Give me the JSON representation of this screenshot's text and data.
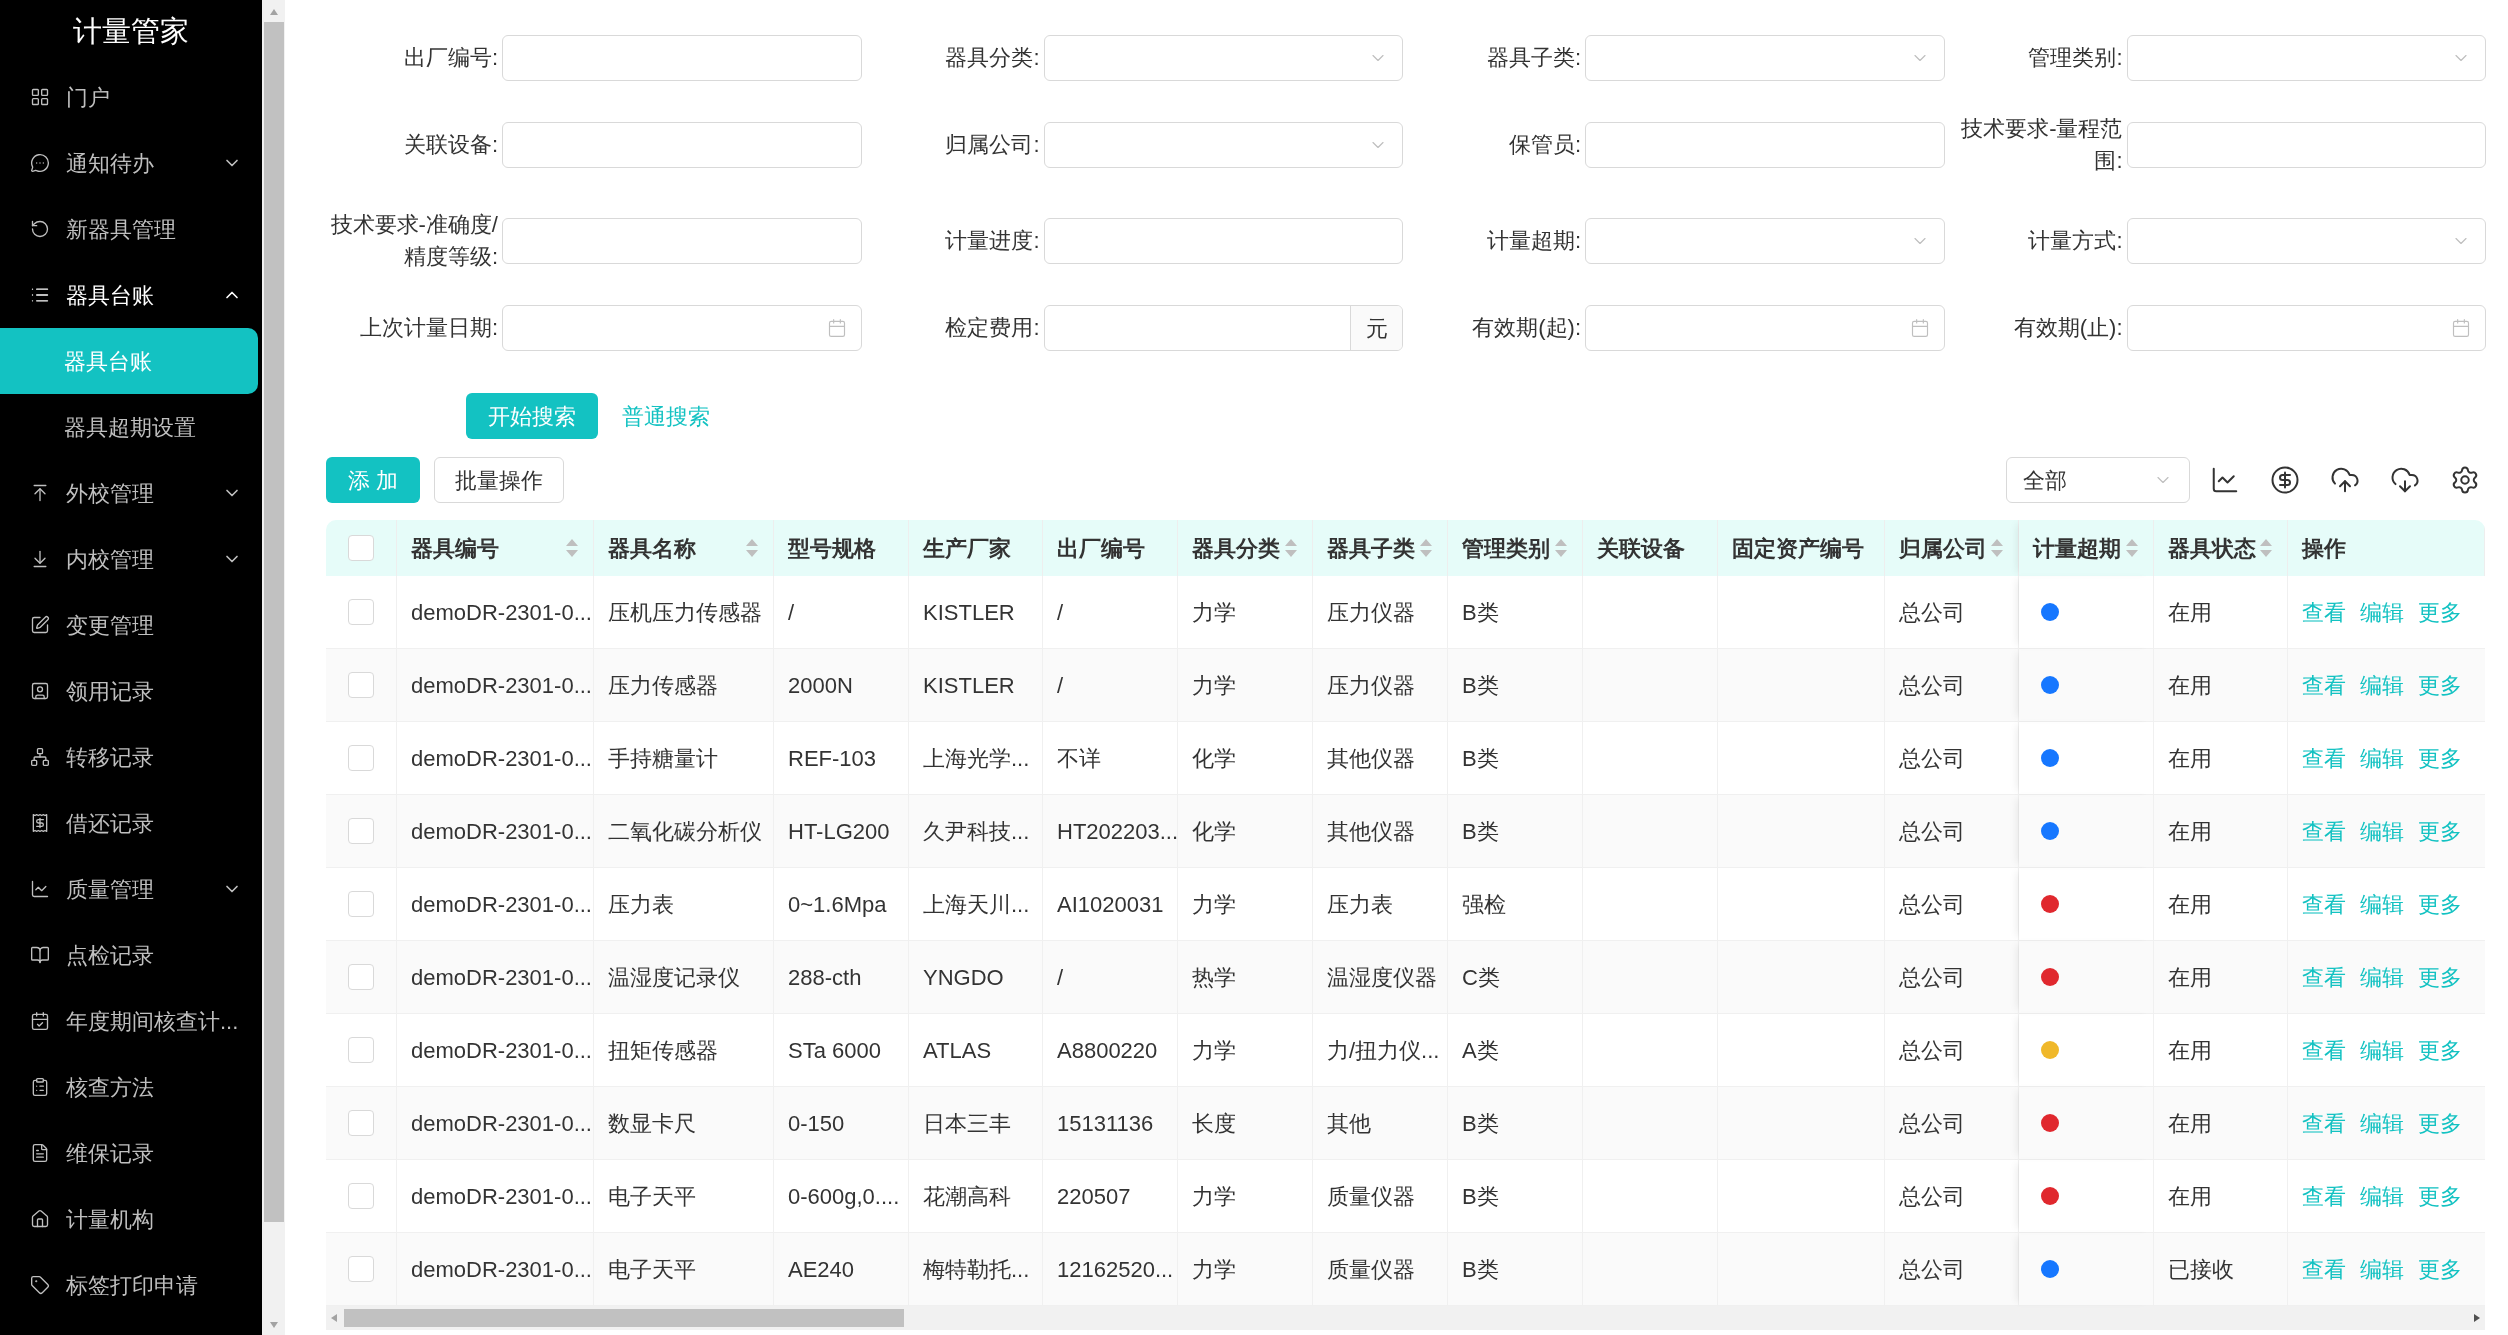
{
  "sidebar": {
    "title": "计量管家",
    "items": [
      {
        "label": "门户",
        "selected": false
      },
      {
        "label": "通知待办",
        "selected": false,
        "expanded": false
      },
      {
        "label": "新器具管理",
        "selected": false
      },
      {
        "label": "器具台账",
        "selected": false,
        "expanded": true,
        "children": [
          {
            "label": "器具台账",
            "selected": true
          },
          {
            "label": "器具超期设置",
            "selected": false
          }
        ]
      },
      {
        "label": "外校管理",
        "selected": false,
        "expanded": false
      },
      {
        "label": "内校管理",
        "selected": false,
        "expanded": false
      },
      {
        "label": "变更管理",
        "selected": false
      },
      {
        "label": "领用记录",
        "selected": false
      },
      {
        "label": "转移记录",
        "selected": false
      },
      {
        "label": "借还记录",
        "selected": false
      },
      {
        "label": "质量管理",
        "selected": false,
        "expanded": false
      },
      {
        "label": "点检记录",
        "selected": false
      },
      {
        "label": "年度期间核查计...",
        "selected": false
      },
      {
        "label": "核查方法",
        "selected": false
      },
      {
        "label": "维保记录",
        "selected": false
      },
      {
        "label": "计量机构",
        "selected": false
      },
      {
        "label": "标签打印申请",
        "selected": false
      }
    ]
  },
  "filters": [
    {
      "label": "出厂编号:",
      "kind": "text"
    },
    {
      "label": "器具分类:",
      "kind": "select"
    },
    {
      "label": "器具子类:",
      "kind": "select"
    },
    {
      "label": "管理类别:",
      "kind": "select"
    },
    {
      "label": "关联设备:",
      "kind": "text"
    },
    {
      "label": "归属公司:",
      "kind": "select"
    },
    {
      "label": "保管员:",
      "kind": "text"
    },
    {
      "label": "技术要求-量程范围:",
      "kind": "text"
    },
    {
      "label": "技术要求-准确度/精度等级:",
      "kind": "text"
    },
    {
      "label": "计量进度:",
      "kind": "text"
    },
    {
      "label": "计量超期:",
      "kind": "select"
    },
    {
      "label": "计量方式:",
      "kind": "select"
    },
    {
      "label": "上次计量日期:",
      "kind": "date"
    },
    {
      "label": "检定费用:",
      "kind": "currency",
      "suffix": "元"
    },
    {
      "label": "有效期(起):",
      "kind": "date"
    },
    {
      "label": "有效期(止):",
      "kind": "date"
    }
  ],
  "search_button": "开始搜索",
  "simple_search_link": "普通搜索",
  "add_button": "添 加",
  "batch_button": "批量操作",
  "scope_select": {
    "value": "全部"
  },
  "table": {
    "all_checked": false,
    "columns": [
      {
        "label": "器具编号",
        "sortable": true
      },
      {
        "label": "器具名称",
        "sortable": true
      },
      {
        "label": "型号规格",
        "sortable": false
      },
      {
        "label": "生产厂家",
        "sortable": false
      },
      {
        "label": "出厂编号",
        "sortable": false
      },
      {
        "label": "器具分类",
        "sortable": true
      },
      {
        "label": "器具子类",
        "sortable": true
      },
      {
        "label": "管理类别",
        "sortable": true
      },
      {
        "label": "关联设备",
        "sortable": false
      },
      {
        "label": "固定资产编号",
        "sortable": false
      },
      {
        "label": "归属公司",
        "sortable": true
      },
      {
        "label": "计量超期",
        "sortable": true
      },
      {
        "label": "器具状态",
        "sortable": true
      },
      {
        "label": "操作",
        "sortable": false
      }
    ],
    "rows": [
      {
        "checked": false,
        "id": "demoDR-2301-0...",
        "name": "压机压力传感器",
        "model": "/",
        "maker": "KISTLER",
        "serial": "/",
        "category": "力学",
        "subcategory": "压力仪器",
        "mgmt_class": "B类",
        "company": "总公司",
        "color": "#1677ff",
        "status": "在用",
        "actions": [
          "查看",
          "编辑",
          "更多"
        ]
      },
      {
        "checked": false,
        "id": "demoDR-2301-0...",
        "name": "压力传感器",
        "model": "2000N",
        "maker": "KISTLER",
        "serial": "/",
        "category": "力学",
        "subcategory": "压力仪器",
        "mgmt_class": "B类",
        "company": "总公司",
        "color": "#1677ff",
        "status": "在用",
        "actions": [
          "查看",
          "编辑",
          "更多"
        ]
      },
      {
        "checked": false,
        "id": "demoDR-2301-0...",
        "name": "手持糖量计",
        "model": "REF-103",
        "maker": "上海光学...",
        "serial": "不详",
        "category": "化学",
        "subcategory": "其他仪器",
        "mgmt_class": "B类",
        "company": "总公司",
        "color": "#1677ff",
        "status": "在用",
        "actions": [
          "查看",
          "编辑",
          "更多"
        ]
      },
      {
        "checked": false,
        "id": "demoDR-2301-0...",
        "name": "二氧化碳分析仪",
        "model": "HT-LG200",
        "maker": "久尹科技...",
        "serial": "HT202203...",
        "category": "化学",
        "subcategory": "其他仪器",
        "mgmt_class": "B类",
        "company": "总公司",
        "color": "#1677ff",
        "status": "在用",
        "actions": [
          "查看",
          "编辑",
          "更多"
        ]
      },
      {
        "checked": false,
        "id": "demoDR-2301-0...",
        "name": "压力表",
        "model": "0~1.6Mpa",
        "maker": "上海天川...",
        "serial": "AI1020031",
        "category": "力学",
        "subcategory": "压力表",
        "mgmt_class": "强检",
        "company": "总公司",
        "color": "#e0282e",
        "status": "在用",
        "actions": [
          "查看",
          "编辑",
          "更多"
        ]
      },
      {
        "checked": false,
        "id": "demoDR-2301-0...",
        "name": "温湿度记录仪",
        "model": "288-cth",
        "maker": "YNGDO",
        "serial": "/",
        "category": "热学",
        "subcategory": "温湿度仪器",
        "mgmt_class": "C类",
        "company": "总公司",
        "color": "#e0282e",
        "status": "在用",
        "actions": [
          "查看",
          "编辑",
          "更多"
        ]
      },
      {
        "checked": false,
        "id": "demoDR-2301-0...",
        "name": "扭矩传感器",
        "model": "STa 6000",
        "maker": "ATLAS",
        "serial": "A8800220",
        "category": "力学",
        "subcategory": "力/扭力仪...",
        "mgmt_class": "A类",
        "company": "总公司",
        "color": "#f0b82a",
        "status": "在用",
        "actions": [
          "查看",
          "编辑",
          "更多"
        ]
      },
      {
        "checked": false,
        "id": "demoDR-2301-0...",
        "name": "数显卡尺",
        "model": "0-150",
        "maker": "日本三丰",
        "serial": "15131136",
        "category": "长度",
        "subcategory": "其他",
        "mgmt_class": "B类",
        "company": "总公司",
        "color": "#e0282e",
        "status": "在用",
        "actions": [
          "查看",
          "编辑",
          "更多"
        ]
      },
      {
        "checked": false,
        "id": "demoDR-2301-0...",
        "name": "电子天平",
        "model": "0-600g,0....",
        "maker": "花潮高科",
        "serial": "220507",
        "category": "力学",
        "subcategory": "质量仪器",
        "mgmt_class": "B类",
        "company": "总公司",
        "color": "#e0282e",
        "status": "在用",
        "actions": [
          "查看",
          "编辑",
          "更多"
        ]
      },
      {
        "checked": false,
        "id": "demoDR-2301-0...",
        "name": "电子天平",
        "model": "AE240",
        "maker": "梅特勒托...",
        "serial": "12162520...",
        "category": "力学",
        "subcategory": "质量仪器",
        "mgmt_class": "B类",
        "company": "总公司",
        "color": "#1677ff",
        "status": "已接收",
        "actions": [
          "查看",
          "编辑",
          "更多"
        ]
      }
    ]
  }
}
